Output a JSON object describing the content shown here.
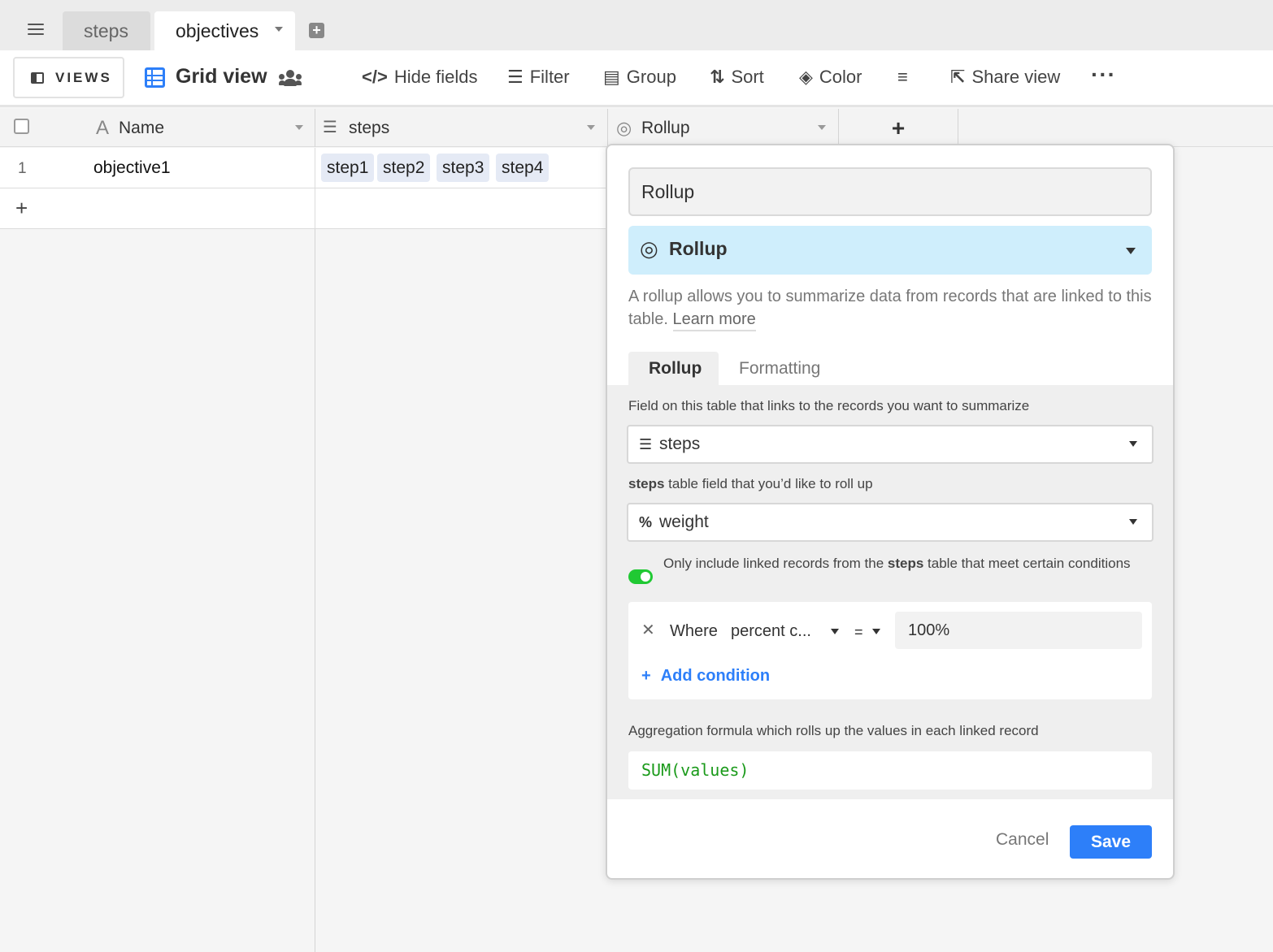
{
  "tabs": [
    {
      "label": "steps"
    },
    {
      "label": "objectives"
    }
  ],
  "toolbar": {
    "views_label": "VIEWS",
    "view_name": "Grid view",
    "hide_fields": "Hide fields",
    "filter": "Filter",
    "group": "Group",
    "sort": "Sort",
    "color": "Color",
    "share_view": "Share view",
    "more": "···"
  },
  "grid": {
    "columns": [
      {
        "label": "Name",
        "icon": "text-icon"
      },
      {
        "label": "steps",
        "icon": "link-icon"
      },
      {
        "label": "Rollup",
        "icon": "rollup-icon"
      }
    ],
    "add_column": "+",
    "rows": [
      {
        "number": "1",
        "name": "objective1",
        "steps": [
          "step1",
          "step2",
          "step3",
          "step4"
        ]
      }
    ],
    "add_row": "+"
  },
  "field_editor": {
    "field_name": "Rollup",
    "field_type": "Rollup",
    "description": "A rollup allows you to summarize data from records that are linked to this table.",
    "learn_more": "Learn more",
    "tabs": [
      "Rollup",
      "Formatting"
    ],
    "link_label": "Field on this table that links to the records you want to summarize",
    "link_field": "steps",
    "rollup_label_bold": "steps",
    "rollup_label_rest": " table field that you’d like to roll up",
    "rollup_field": "weight",
    "condition_toggle": true,
    "condition_text_pre": "Only include linked records from the ",
    "condition_text_bold": "steps",
    "condition_text_post": " table that meet certain conditions",
    "condition": {
      "prefix": "Where",
      "field": "percent c...",
      "operator": "=",
      "value": "100%"
    },
    "add_condition": "Add condition",
    "aggregation_label": "Aggregation formula which rolls up the values in each linked record",
    "formula": "SUM(values)",
    "cancel": "Cancel",
    "save": "Save"
  },
  "colors": {
    "accent": "#2d7ff9",
    "type_select_bg": "#cfeefc",
    "toggle_on": "#20c933",
    "formula_text": "#1a9a1a"
  }
}
